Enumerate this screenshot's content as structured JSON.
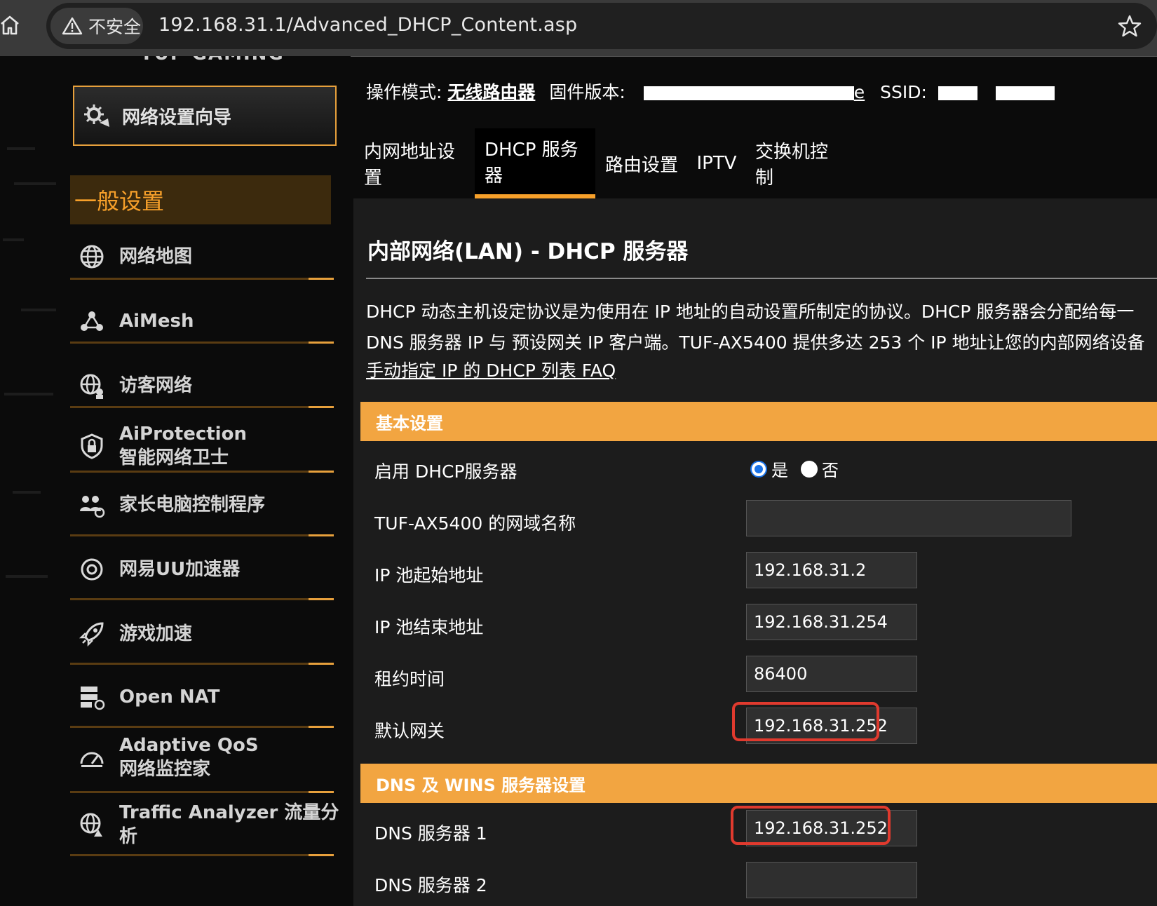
{
  "browser": {
    "security_label": "不安全",
    "url": "192.168.31.1/Advanced_DHCP_Content.asp"
  },
  "sidebar": {
    "brand": "TUF GAMING",
    "wizard_label": "网络设置向导",
    "section_header": "一般设置",
    "items": [
      {
        "label": "网络地图",
        "icon": "globe-icon"
      },
      {
        "label": "AiMesh",
        "icon": "mesh-icon"
      },
      {
        "label": "访客网络",
        "icon": "guest-network-icon"
      },
      {
        "label": "AiProtection",
        "label2": "智能网络卫士",
        "icon": "shield-lock-icon"
      },
      {
        "label": "家长电脑控制程序",
        "icon": "parental-control-icon"
      },
      {
        "label": "网易UU加速器",
        "icon": "uu-accelerator-icon"
      },
      {
        "label": "游戏加速",
        "icon": "rocket-icon"
      },
      {
        "label": "Open NAT",
        "icon": "open-nat-icon"
      },
      {
        "label": "Adaptive QoS",
        "label2": "网络监控家",
        "icon": "gauge-icon"
      },
      {
        "label": "Traffic Analyzer 流量分析",
        "icon": "traffic-analyzer-icon"
      }
    ]
  },
  "header": {
    "mode_label": "操作模式:",
    "mode_value": "无线路由器",
    "firmware_label": "固件版本:",
    "firmware_end": "e",
    "ssid_label": "SSID:"
  },
  "tabs": [
    {
      "label": "内网地址设置",
      "active": false
    },
    {
      "label": "DHCP 服务器",
      "active": true
    },
    {
      "label": "路由设置",
      "active": false
    },
    {
      "label": "IPTV",
      "active": false
    },
    {
      "label": "交换机控制",
      "active": false
    }
  ],
  "content": {
    "title": "内部网络(LAN) - DHCP 服务器",
    "desc_line1": "DHCP 动态主机设定协议是为使用在 IP 地址的自动设置所制定的协议。DHCP 服务器会分配给每一",
    "desc_line2": "DNS 服务器 IP 与 预设网关 IP 客户端。TUF-AX5400 提供多达 253 个 IP 地址让您的内部网络设备",
    "faq_link": "手动指定 IP 的 DHCP 列表 FAQ",
    "basic_group": "基本设置",
    "dhcp_enable_label": "启用 DHCP服务器",
    "radio_yes": "是",
    "radio_no": "否",
    "dhcp_enabled": true,
    "domain_label": "TUF-AX5400 的网域名称",
    "domain_value": "",
    "pool_start_label": "IP 池起始地址",
    "pool_start_value": "192.168.31.2",
    "pool_end_label": "IP 池结束地址",
    "pool_end_value": "192.168.31.254",
    "lease_label": "租约时间",
    "lease_value": "86400",
    "gateway_label": "默认网关",
    "gateway_value": "192.168.31.252",
    "dns_group": "DNS 及 WINS 服务器设置",
    "dns1_label": "DNS 服务器 1",
    "dns1_value": "192.168.31.252",
    "dns2_label": "DNS 服务器 2",
    "dns2_value": ""
  },
  "colors": {
    "accent_orange": "#f2a541",
    "highlight_red": "#e03a2e",
    "panel_bg": "#1c1c1c"
  }
}
